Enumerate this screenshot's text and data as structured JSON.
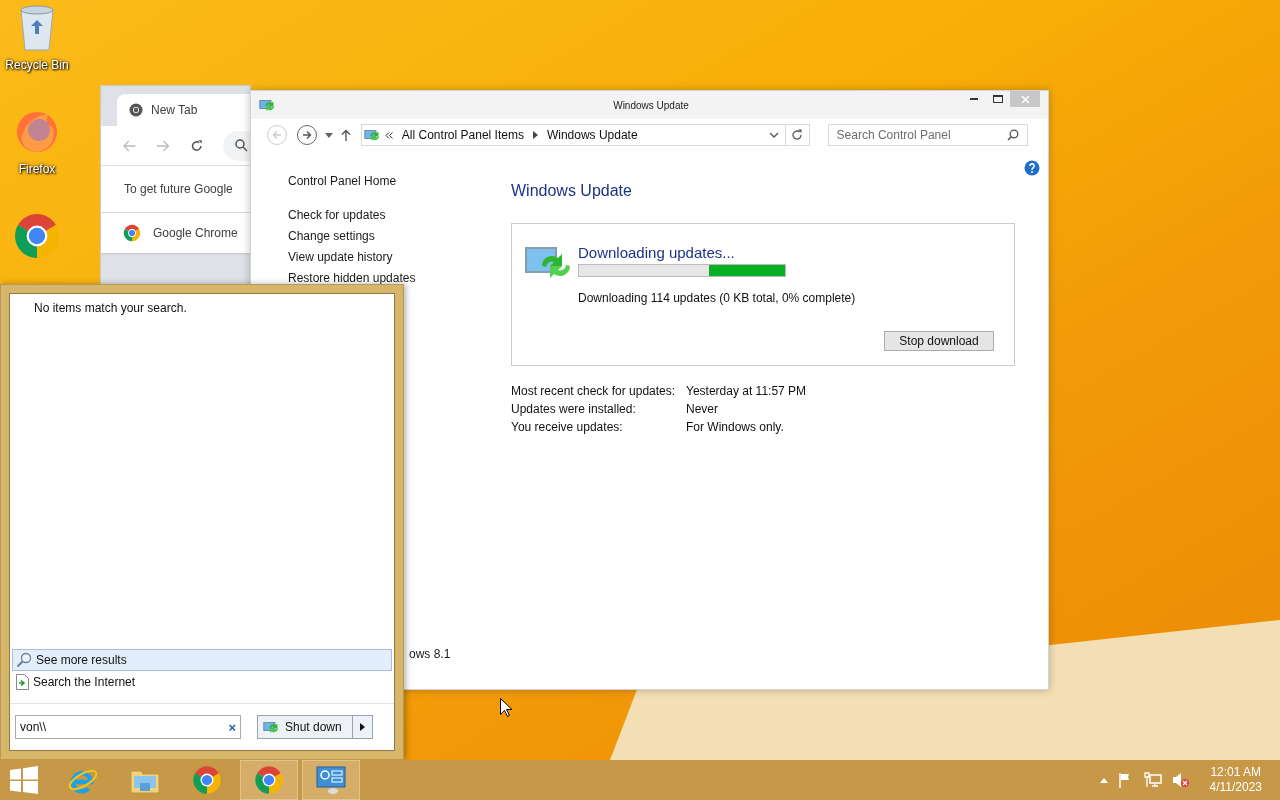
{
  "desktop_icons": [
    {
      "kind": "recycle",
      "label": "Recycle Bin"
    },
    {
      "kind": "firefox",
      "label": "Firefox"
    },
    {
      "kind": "chrome"
    }
  ],
  "browser_window": {
    "tab": "New Tab",
    "notice": "To get future Google",
    "row": "Google Chrome"
  },
  "control_panel": {
    "title": "Windows Update",
    "breadcrumb": [
      "All Control Panel Items",
      "Windows Update"
    ],
    "search_placeholder": "Search Control Panel",
    "nav": [
      "Control Panel Home",
      "Check for updates",
      "Change settings",
      "View update history",
      "Restore hidden updates"
    ],
    "heading": "Windows Update",
    "status": {
      "title": "Downloading updates...",
      "level": 0.37,
      "detail": "Downloading 114 updates (0 KB total, 0% complete)",
      "button": "Stop download"
    },
    "info": [
      {
        "label": "Most recent check for updates:",
        "value": "Yesterday at 11:57 PM"
      },
      {
        "label": "Updates were installed:",
        "value": "Never"
      },
      {
        "label": "You receive updates:",
        "value": "For Windows only."
      }
    ],
    "footer": "ows 8.1"
  },
  "start_menu": {
    "message": "No items match your search.",
    "links": [
      {
        "kind": "search",
        "label": "See more results",
        "selected": true
      },
      {
        "kind": "internet",
        "label": "Search the Internet",
        "selected": false
      }
    ],
    "search": {
      "value": "von\\\\",
      "clear": "×"
    },
    "power_button": "Shut down"
  },
  "taskbar": {
    "apps": [
      {
        "kind": "ie",
        "active": false
      },
      {
        "kind": "explorer",
        "active": false
      },
      {
        "kind": "chrome",
        "active": false
      },
      {
        "kind": "chrome",
        "active": true
      },
      {
        "kind": "control",
        "active": true
      }
    ],
    "clock": {
      "time": "12:01 AM",
      "date": "4/11/2023"
    }
  }
}
